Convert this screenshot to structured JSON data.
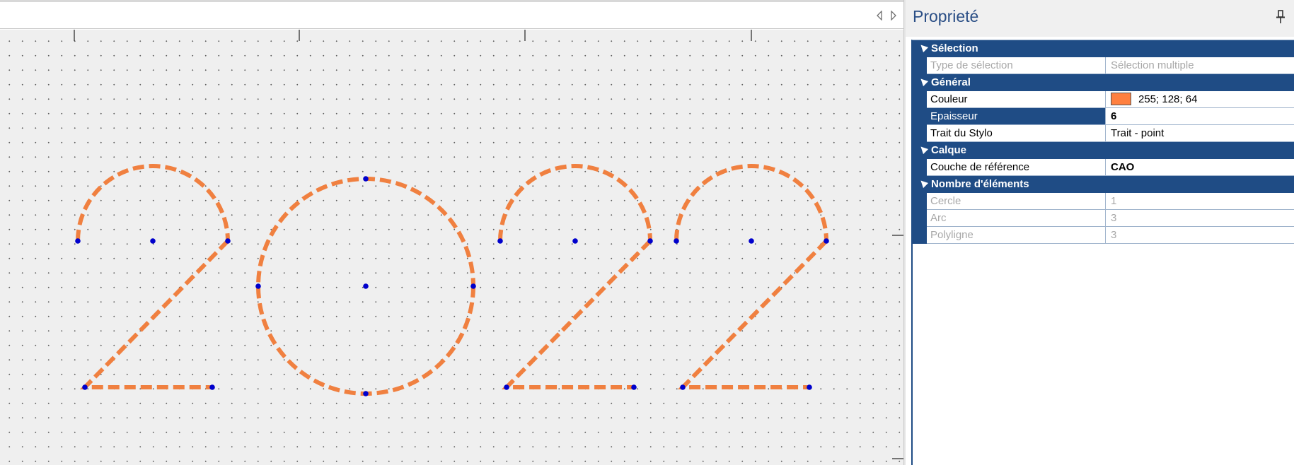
{
  "panel": {
    "title": "Proprieté",
    "pin_icon": "pin-icon",
    "sections": [
      {
        "label": "Sélection",
        "rows": [
          {
            "name": "Type de sélection",
            "value": "Sélection multiple",
            "disabled": true
          }
        ]
      },
      {
        "label": "Général",
        "rows": [
          {
            "name": "Couleur",
            "value": "255; 128; 64",
            "swatch": "#ff8040"
          },
          {
            "name": "Epaisseur",
            "value": "6",
            "selected": true,
            "bold": true
          },
          {
            "name": "Trait du Stylo",
            "value": "Trait - point"
          }
        ]
      },
      {
        "label": "Calque",
        "rows": [
          {
            "name": "Couche de référence",
            "value": "CAO",
            "bold": true
          }
        ]
      },
      {
        "label": "Nombre d'éléments",
        "rows": [
          {
            "name": "Cercle",
            "value": "1",
            "disabled": true
          },
          {
            "name": "Arc",
            "value": "3",
            "disabled": true
          },
          {
            "name": "Polyligne",
            "value": "3",
            "disabled": true
          }
        ]
      }
    ]
  },
  "colors": {
    "stroke": "#f08040",
    "handle": "#0000cc",
    "header_blue": "#1f4c85",
    "title_blue": "#2b4f86",
    "canvas_bg": "#efefef"
  },
  "tabbar": {
    "prev_icon": "chevron-left-icon",
    "next_icon": "chevron-right-icon"
  }
}
